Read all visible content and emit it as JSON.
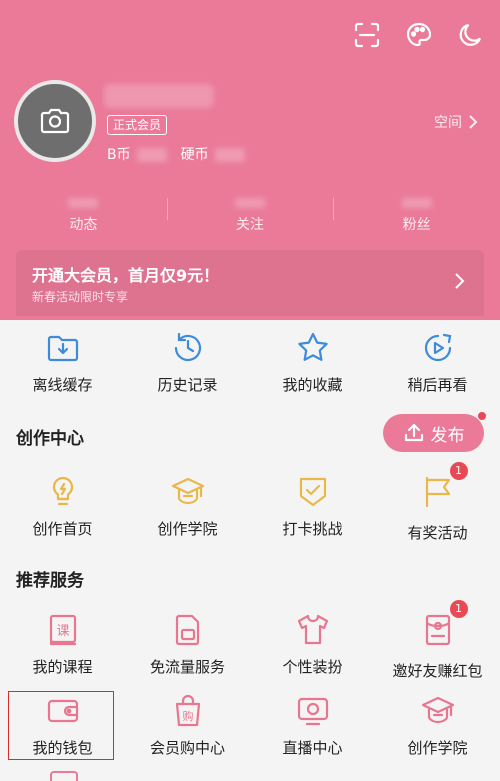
{
  "colors": {
    "brand": "#ea7a98",
    "icon_blue": "#3d8bd9",
    "icon_yellow": "#e8b84a",
    "icon_pink": "#e8768f",
    "red": "#e84a55"
  },
  "header": {
    "top_icons": [
      "scan-icon",
      "palette-icon",
      "moon-icon"
    ],
    "member_badge": "正式会员",
    "b_coin_label": "B币",
    "coin_label": "硬币",
    "space_link": "空间",
    "stats": [
      {
        "label": "动态"
      },
      {
        "label": "关注"
      },
      {
        "label": "粉丝"
      }
    ]
  },
  "vip": {
    "title": "开通大会员，首月仅9元！",
    "subtitle": "新春活动限时专享"
  },
  "quick": [
    {
      "label": "离线缓存",
      "icon": "download-folder-icon"
    },
    {
      "label": "历史记录",
      "icon": "history-icon"
    },
    {
      "label": "我的收藏",
      "icon": "star-icon"
    },
    {
      "label": "稍后再看",
      "icon": "play-later-icon"
    }
  ],
  "creation": {
    "title": "创作中心",
    "publish_label": "发布",
    "items": [
      {
        "label": "创作首页",
        "icon": "bulb-icon"
      },
      {
        "label": "创作学院",
        "icon": "graduation-cap-icon"
      },
      {
        "label": "打卡挑战",
        "icon": "badge-check-icon"
      },
      {
        "label": "有奖活动",
        "icon": "flag-icon",
        "badge": "1"
      }
    ]
  },
  "services": {
    "title": "推荐服务",
    "row1": [
      {
        "label": "我的课程",
        "icon": "course-book-icon"
      },
      {
        "label": "免流量服务",
        "icon": "sim-card-icon"
      },
      {
        "label": "个性装扮",
        "icon": "tshirt-icon"
      },
      {
        "label": "邀好友赚红包",
        "icon": "red-packet-icon",
        "badge": "1"
      }
    ],
    "row2": [
      {
        "label": "我的钱包",
        "icon": "wallet-icon"
      },
      {
        "label": "会员购中心",
        "icon": "shopping-bag-icon"
      },
      {
        "label": "直播中心",
        "icon": "live-tv-icon"
      },
      {
        "label": "创作学院",
        "icon": "graduation-cap-icon"
      }
    ]
  }
}
